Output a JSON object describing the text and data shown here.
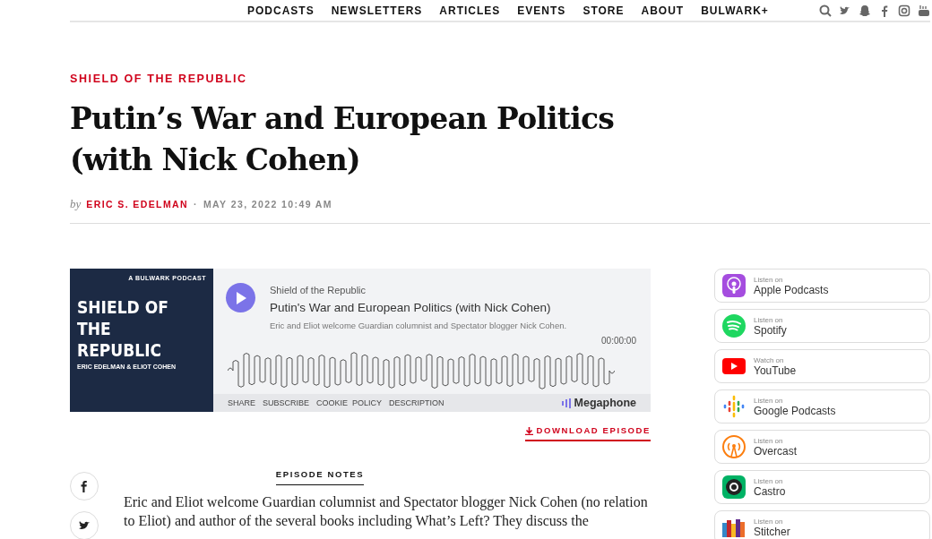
{
  "nav": {
    "items": [
      "PODCASTS",
      "NEWSLETTERS",
      "ARTICLES",
      "EVENTS",
      "STORE",
      "ABOUT",
      "BULWARK+"
    ],
    "icons": [
      {
        "kind": "search"
      },
      {
        "kind": "twitter"
      },
      {
        "kind": "snapchat"
      },
      {
        "kind": "facebook"
      },
      {
        "kind": "instagram"
      },
      {
        "kind": "youtube"
      }
    ]
  },
  "article": {
    "kicker": "SHIELD OF THE REPUBLIC",
    "title": "Putin’s War and European Politics (with Nick Cohen)",
    "by": "by",
    "author": "ERIC S. EDELMAN",
    "separator": "·",
    "date": "MAY 23, 2022 10:49 AM"
  },
  "player": {
    "cover": {
      "label": "A BULWARK PODCAST",
      "title": "SHIELD OF THE REPUBLIC",
      "hosts": "ERIC EDELMAN & ELIOT COHEN"
    },
    "show": "Shield of the Republic",
    "episode": "Putin's War and European Politics (with Nick Cohen)",
    "description": "Eric and Eliot welcome Guardian columnist and Spectator blogger Nick Cohen.",
    "time": "00:00:00",
    "links": [
      "SHARE",
      "SUBSCRIBE",
      "COOKIE  POLICY",
      "DESCRIPTION"
    ],
    "brand": "Megaphone"
  },
  "download": "DOWNLOAD EPISODE",
  "platforms": [
    {
      "kind": "apple",
      "caption": "Listen on",
      "name": "Apple Podcasts"
    },
    {
      "kind": "spotify",
      "caption": "Listen on",
      "name": "Spotify"
    },
    {
      "kind": "youtube",
      "caption": "Watch on",
      "name": "YouTube"
    },
    {
      "kind": "google",
      "caption": "Listen on",
      "name": "Google Podcasts"
    },
    {
      "kind": "overcast",
      "caption": "Listen on",
      "name": "Overcast"
    },
    {
      "kind": "castro",
      "caption": "Listen on",
      "name": "Castro"
    },
    {
      "kind": "stitcher",
      "caption": "Listen on",
      "name": "Stitcher"
    }
  ],
  "share_buttons": [
    {
      "kind": "facebook"
    },
    {
      "kind": "twitter"
    }
  ],
  "notes": {
    "heading": "EPISODE NOTES",
    "text": "Eric and Eliot welcome Guardian columnist and Spectator blogger Nick Cohen (no relation to Eliot) and author of the several books including What’s Left? They discuss the"
  }
}
